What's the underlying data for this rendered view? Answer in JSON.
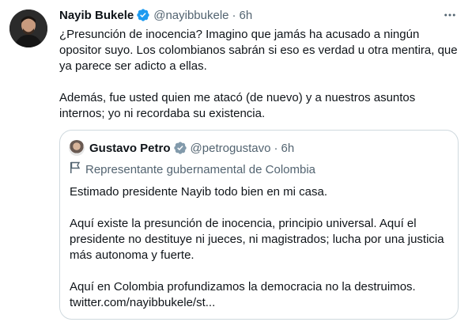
{
  "tweet": {
    "author_name": "Nayib Bukele",
    "handle": "@nayibbukele",
    "separator": "·",
    "time": "6h",
    "paragraphs": [
      "¿Presunción de inocencia? Imagino que jamás ha acusado a ningún opositor suyo. Los colombianos sabrán si eso es verdad u otra mentira, que ya parece ser adicto a ellas.",
      "Además, fue usted quien me atacó (de nuevo) y a nuestros asuntos internos; yo ni recordaba su existencia."
    ],
    "icons": {
      "verified": "verified-badge-icon",
      "more": "more-options-icon"
    },
    "colors": {
      "verified": "#1d9bf0",
      "secondary_text": "#536471",
      "border": "#cfd9de"
    }
  },
  "quoted_tweet": {
    "author_name": "Gustavo Petro",
    "handle": "@petrogustavo",
    "separator": "·",
    "time": "6h",
    "label": "Representante gubernamental de Colombia",
    "paragraphs": [
      "Estimado presidente Nayib todo bien en mi casa.",
      "Aquí existe la presunción de inocencia, principio universal. Aquí el presidente no destituye ni jueces, ni magistrados; lucha por una justicia más autonoma y fuerte.",
      "Aquí en Colombia profundizamos la democracia no la destruimos. twitter.com/nayibbukele/st..."
    ],
    "icons": {
      "label": "flag-icon"
    }
  }
}
